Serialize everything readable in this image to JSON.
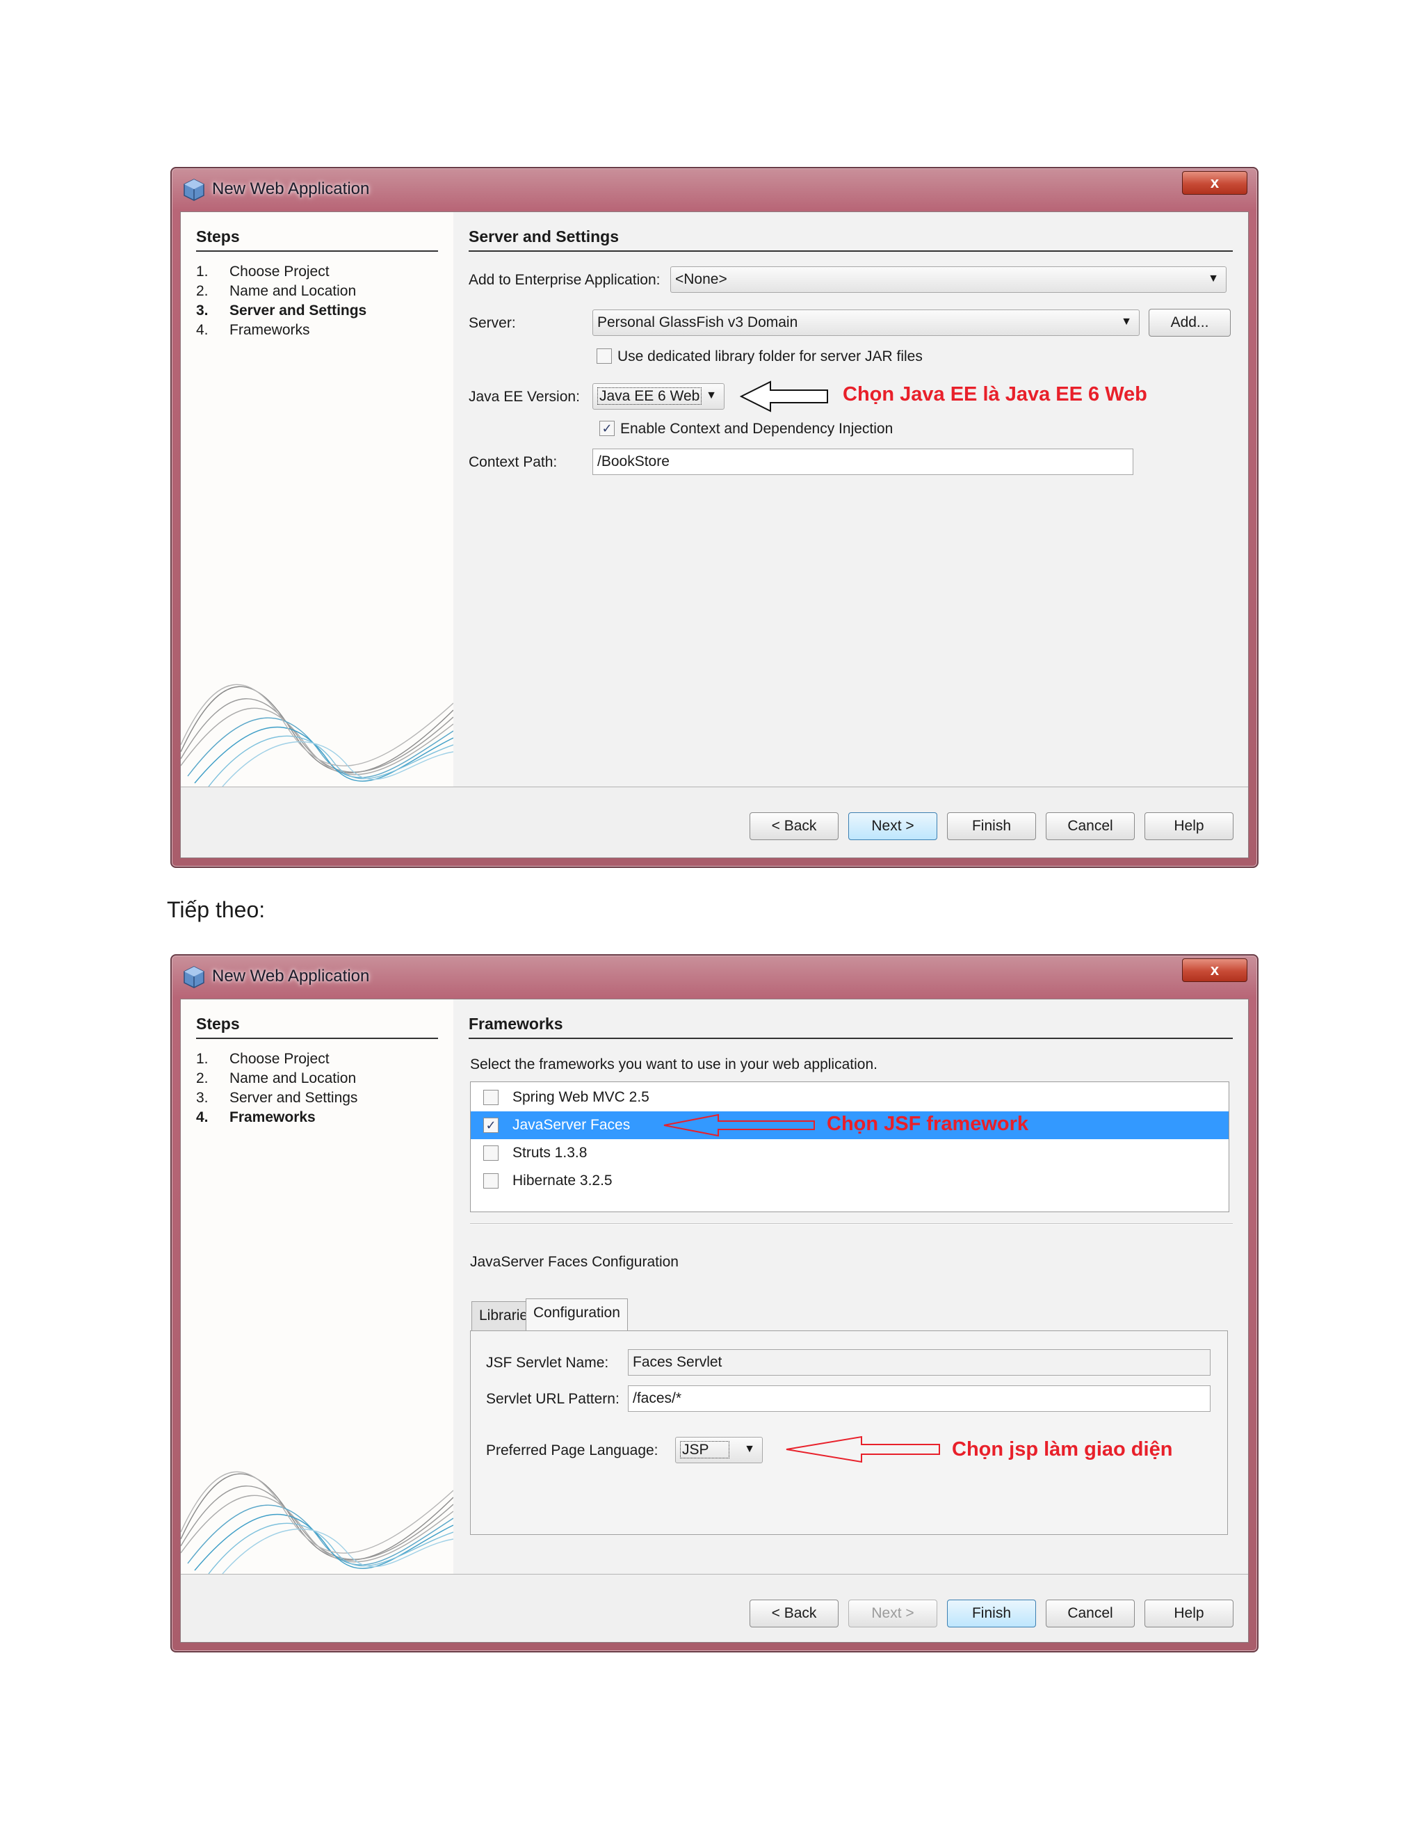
{
  "dialog1": {
    "title": "New Web Application",
    "close_label": "x",
    "steps_title": "Steps",
    "steps": [
      {
        "num": "1.",
        "label": "Choose Project"
      },
      {
        "num": "2.",
        "label": "Name and Location"
      },
      {
        "num": "3.",
        "label": "Server and Settings"
      },
      {
        "num": "4.",
        "label": "Frameworks"
      }
    ],
    "section_title": "Server and Settings",
    "enterprise_label": "Add to Enterprise Application:",
    "enterprise_value": "<None>",
    "server_label": "Server:",
    "server_value": "Personal GlassFish v3 Domain",
    "add_button": "Add...",
    "dedicated_lib_label": "Use dedicated library folder for server JAR files",
    "dedicated_lib_checked": false,
    "javaee_label": "Java EE Version:",
    "javaee_value": "Java EE 6 Web",
    "cdi_label": "Enable Context and Dependency Injection",
    "cdi_checked": true,
    "context_label": "Context Path:",
    "context_value": "/BookStore",
    "annotation": "Chọn Java EE là Java EE 6 Web",
    "buttons": {
      "back": "< Back",
      "next": "Next >",
      "finish": "Finish",
      "cancel": "Cancel",
      "help": "Help"
    }
  },
  "caption": "Tiếp theo:",
  "dialog2": {
    "title": "New Web Application",
    "close_label": "x",
    "steps_title": "Steps",
    "steps": [
      {
        "num": "1.",
        "label": "Choose Project"
      },
      {
        "num": "2.",
        "label": "Name and Location"
      },
      {
        "num": "3.",
        "label": "Server and Settings"
      },
      {
        "num": "4.",
        "label": "Frameworks"
      }
    ],
    "section_title": "Frameworks",
    "instruction": "Select the frameworks you want to use in your web application.",
    "frameworks": [
      {
        "label": "Spring Web MVC 2.5",
        "checked": false,
        "selected": false
      },
      {
        "label": "JavaServer Faces",
        "checked": true,
        "selected": true
      },
      {
        "label": "Struts 1.3.8",
        "checked": false,
        "selected": false
      },
      {
        "label": "Hibernate 3.2.5",
        "checked": false,
        "selected": false
      }
    ],
    "framework_annotation": "Chọn JSF framework",
    "config_title": "JavaServer Faces Configuration",
    "tabs": [
      "Libraries",
      "Configuration"
    ],
    "active_tab": "Configuration",
    "servlet_name_label": "JSF Servlet Name:",
    "servlet_name_value": "Faces Servlet",
    "url_pattern_label": "Servlet URL Pattern:",
    "url_pattern_value": "/faces/*",
    "page_lang_label": "Preferred Page Language:",
    "page_lang_value": "JSP",
    "page_lang_annotation": "Chọn jsp làm giao diện",
    "buttons": {
      "back": "< Back",
      "next": "Next >",
      "finish": "Finish",
      "cancel": "Cancel",
      "help": "Help"
    }
  },
  "colors": {
    "annotation": "#e8202a",
    "selection": "#3399ff",
    "title_bar": "#b86677"
  }
}
